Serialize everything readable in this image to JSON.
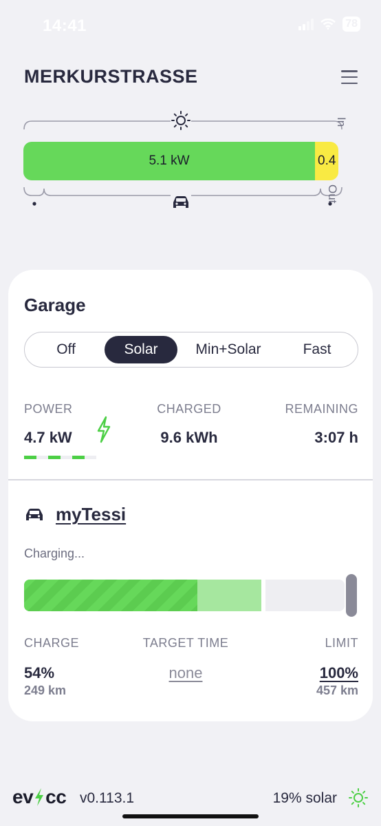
{
  "status_bar": {
    "time": "14:41",
    "battery": "78"
  },
  "header": {
    "title": "MERKURSTRASSE"
  },
  "energyflow": {
    "bar_primary_label": "5.1 kW",
    "bar_secondary_label": "0.4",
    "in_label": "In",
    "out_label": "Out",
    "colors": {
      "solar": "#66d85a",
      "grid": "#f9ea43"
    }
  },
  "loadpoint": {
    "title": "Garage",
    "modes": [
      {
        "label": "Off",
        "active": false
      },
      {
        "label": "Solar",
        "active": true
      },
      {
        "label": "Min+Solar",
        "active": false
      },
      {
        "label": "Fast",
        "active": false
      }
    ],
    "power_label": "POWER",
    "power_value": "4.7 kW",
    "charged_label": "CHARGED",
    "charged_value": "9.6 kWh",
    "remaining_label": "REMAINING",
    "remaining_value": "3:07 h"
  },
  "vehicle": {
    "name": "myTessi",
    "status": "Charging...",
    "soc_percent": 54,
    "target_percent": 74,
    "charge_label": "CHARGE",
    "charge_value": "54%",
    "charge_range": "249 km",
    "target_time_label": "TARGET TIME",
    "target_time_value": "none",
    "limit_label": "LIMIT",
    "limit_value": "100%",
    "limit_range": "457 km"
  },
  "footer": {
    "logo_left": "ev",
    "logo_right": "cc",
    "version": "v0.113.1",
    "solar_share": "19% solar"
  }
}
